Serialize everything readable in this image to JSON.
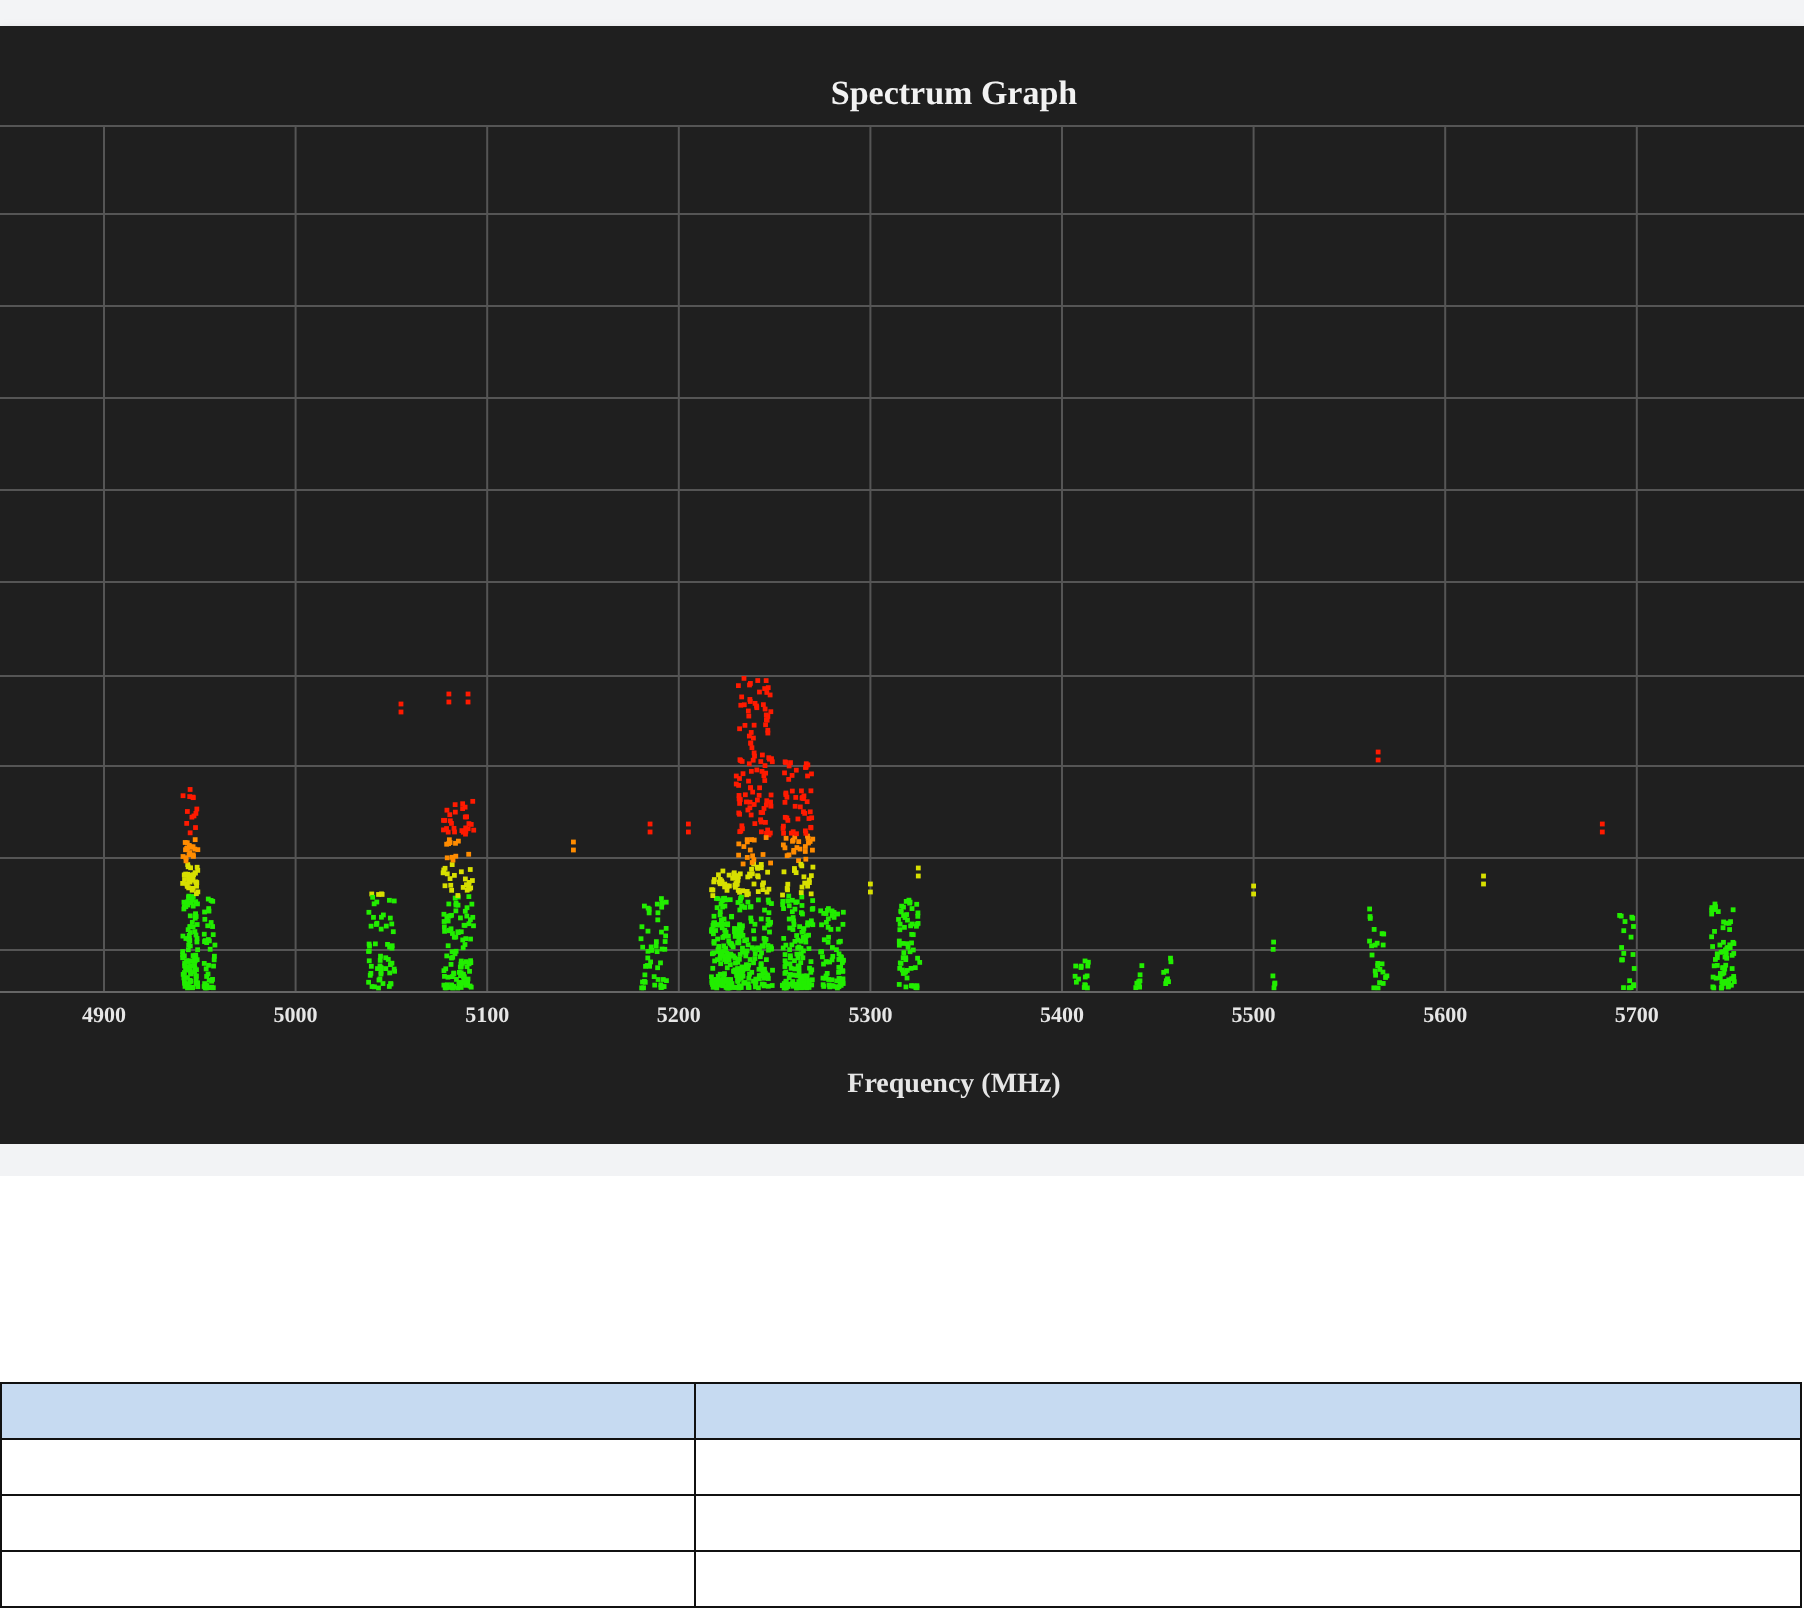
{
  "spectrum_graph": {
    "title": "Spectrum Graph",
    "x_tick_labels": [
      "4900",
      "5000",
      "5100",
      "5200",
      "5300",
      "5400",
      "5500",
      "5600",
      "5700"
    ],
    "x_axis_label": "Frequency (MHz)"
  }
}
